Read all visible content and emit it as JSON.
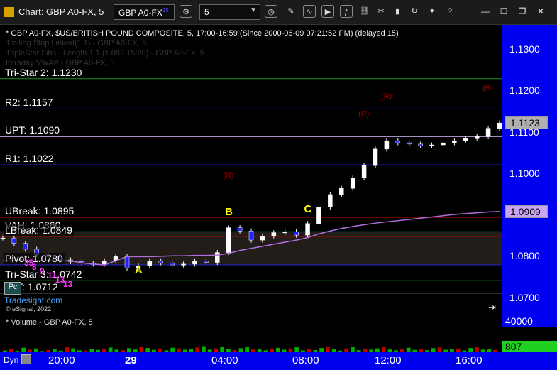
{
  "window": {
    "title": "Chart: GBP A0-FX, 5",
    "symbol": "GBP A0-FX",
    "symbol_sup": "15",
    "interval": "5"
  },
  "header": {
    "line1": "* GBP A0-FX, $US/BRITISH POUND COMPOSITE, 5, 17:00-16:59 (Since 2000-06-09 07:21:52 PM) (delayed 15)",
    "line2": "Trailing Stop Linked(1.1) - GBP A0-FX, 5",
    "line3": "TripleStar Fibs - Length 1.1 (1.082 15:20) - GBP A0-FX, 5",
    "line4": "Intraday VWAP - GBP A0-FX, 5"
  },
  "levels": [
    {
      "label": "Tri-Star 2: 1.1230",
      "price": 1.123,
      "color": "#1f8f1f"
    },
    {
      "label": "R2: 1.1157",
      "price": 1.1157,
      "color": "#2020d0"
    },
    {
      "label": "UPT: 1.1090",
      "price": 1.109,
      "color": "#c0a0e0"
    },
    {
      "label": "R1: 1.1022",
      "price": 1.1022,
      "color": "#2020d0"
    },
    {
      "label": "UBreak: 1.0895",
      "price": 1.0895,
      "color": "#d00000"
    },
    {
      "label": "VAH: 1.0860",
      "price": 1.086,
      "color": "#00d0e0"
    },
    {
      "label": "LBreak: 1.0849",
      "price": 1.0849,
      "color": "#d00000"
    },
    {
      "label": "Pivot: 1.0780",
      "price": 1.078,
      "color": "#2020d0"
    },
    {
      "label": "Tri-Star 3: 1.0742",
      "price": 1.0742,
      "color": "#1f8f1f"
    },
    {
      "label": "LPT: 1.0712",
      "price": 1.0712,
      "color": "#c0a0e0"
    }
  ],
  "price_axis": {
    "ticks": [
      "1.1300",
      "1.1200",
      "1.1100",
      "1.1000",
      "1.0900",
      "1.0800",
      "1.0700"
    ],
    "current_price": "1.1123",
    "vwap_price": "1.0909"
  },
  "chart_data": {
    "type": "candlestick",
    "x": [
      "19:00",
      "19:30",
      "20:00",
      "20:30",
      "21:00",
      "21:30",
      "22:00",
      "22:30",
      "23:00",
      "23:30",
      "00:00",
      "00:30",
      "01:00",
      "01:30",
      "02:00",
      "02:30",
      "03:00",
      "03:30",
      "04:00",
      "04:30",
      "05:00",
      "05:30",
      "06:00",
      "06:30",
      "07:00",
      "07:30",
      "08:00",
      "08:30",
      "09:00",
      "09:30",
      "10:00",
      "10:30",
      "11:00",
      "11:30",
      "12:00",
      "12:30",
      "13:00",
      "13:30",
      "14:00",
      "14:30",
      "15:00",
      "15:30",
      "16:00",
      "16:30",
      "17:00"
    ],
    "close": [
      1.0845,
      1.0832,
      1.0818,
      1.0805,
      1.08,
      1.0792,
      1.0788,
      1.0784,
      1.0782,
      1.079,
      1.08,
      1.0772,
      1.0778,
      1.079,
      1.0785,
      1.078,
      1.0782,
      1.079,
      1.0786,
      1.081,
      1.087,
      1.0862,
      1.084,
      1.085,
      1.0858,
      1.086,
      1.0852,
      1.088,
      1.092,
      1.095,
      1.0965,
      1.099,
      1.102,
      1.106,
      1.108,
      1.1075,
      1.1072,
      1.1068,
      1.107,
      1.1075,
      1.108,
      1.1085,
      1.109,
      1.111,
      1.1123
    ],
    "vwap": [
      1.079,
      1.079,
      1.079,
      1.079,
      1.079,
      1.079,
      1.079,
      1.0785,
      1.0782,
      1.078,
      1.079,
      1.08,
      1.08,
      1.08,
      1.0801,
      1.0802,
      1.0802,
      1.0803,
      1.0803,
      1.0804,
      1.0808,
      1.0815,
      1.082,
      1.0825,
      1.083,
      1.0835,
      1.084,
      1.0846,
      1.0855,
      1.0862,
      1.0868,
      1.0873,
      1.0877,
      1.0881,
      1.0884,
      1.0887,
      1.089,
      1.0893,
      1.0896,
      1.0899,
      1.0902,
      1.0904,
      1.0906,
      1.0908,
      1.0909
    ],
    "ylim": [
      1.066,
      1.136
    ],
    "annotations": [
      {
        "text": "A",
        "x": "01:00",
        "price": 1.0765
      },
      {
        "text": "B",
        "x": "05:00",
        "price": 1.0905
      },
      {
        "text": "C",
        "x": "08:30",
        "price": 1.0912
      }
    ],
    "pivot_markers": [
      {
        "text": "(R)",
        "x": "05:00",
        "price": 1.0995
      },
      {
        "text": "(R)",
        "x": "11:00",
        "price": 1.1142
      },
      {
        "text": "(R)",
        "x": "12:00",
        "price": 1.1185
      },
      {
        "text": "(R)",
        "x": "16:30",
        "price": 1.1205
      }
    ]
  },
  "time_axis": [
    "20:00",
    "29",
    "04:00",
    "08:00",
    "12:00",
    "16:00"
  ],
  "volume": {
    "label": "* Volume - GBP A0-FX, 5",
    "axis_top": "40000",
    "current": "807",
    "values": [
      1200,
      2400,
      900,
      3100,
      1800,
      2600,
      800,
      1500,
      2200,
      1100,
      3400,
      2700,
      1300,
      900,
      2100,
      1600,
      2500,
      3200,
      1800,
      1400,
      2800,
      1900,
      3700,
      2900,
      1600,
      2300,
      1300,
      3100,
      2600,
      1700,
      2400,
      3300,
      4200,
      1800,
      2600,
      3900,
      2100,
      1500,
      2800,
      3600,
      1900,
      2400,
      1300,
      2200,
      3000,
      1700,
      2600,
      3400,
      1200,
      2000,
      1500,
      2900,
      3800,
      2300,
      1100,
      2600,
      3500,
      1400,
      2200,
      1800,
      2700,
      4000,
      1900,
      1300,
      2400,
      3100,
      1600,
      2300,
      1400,
      2800,
      3300,
      1700,
      2000,
      2600,
      1200,
      2900,
      3600,
      1800,
      2200,
      1500
    ]
  },
  "status": {
    "dyn": "Dyn",
    "copyright": "© eSignal, 2022",
    "badge": "Pc",
    "tradesight": "Tradesight.com",
    "count_markers": [
      "35",
      "8",
      "9",
      "11",
      "13",
      "13"
    ]
  }
}
